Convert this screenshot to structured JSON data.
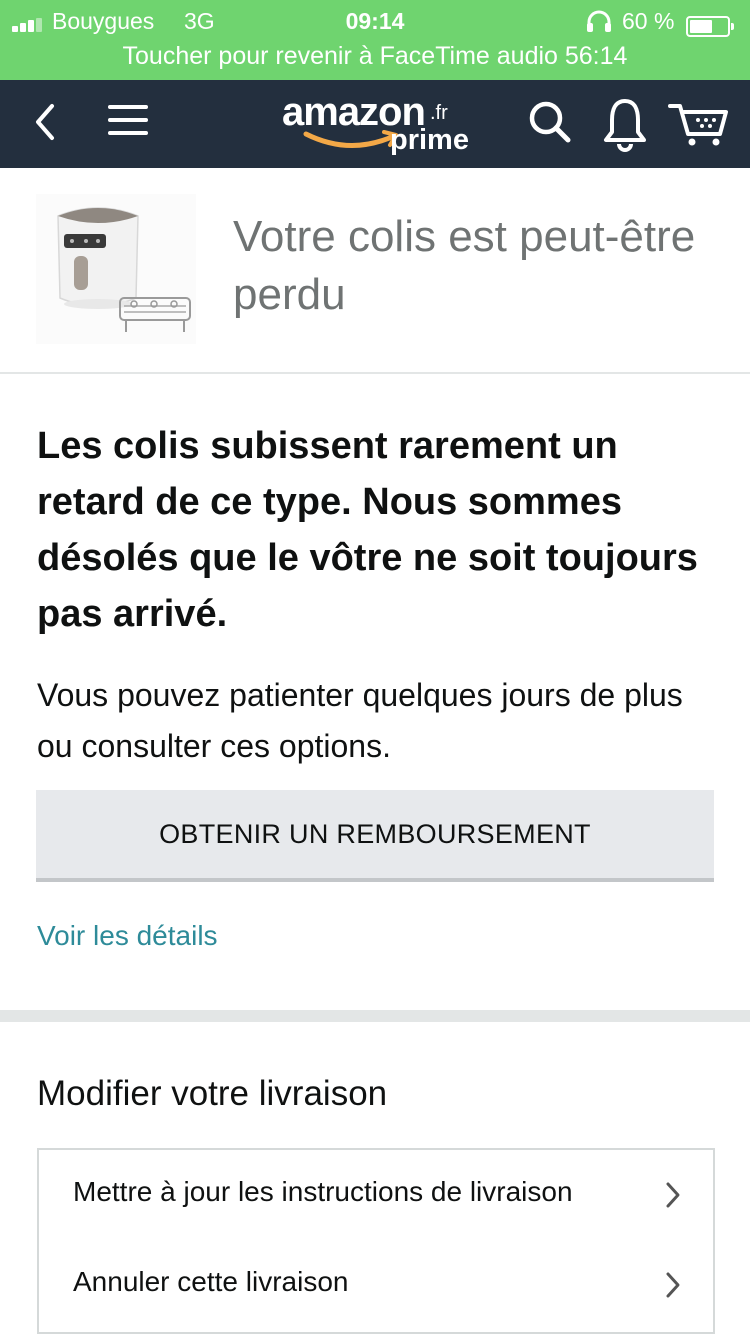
{
  "status_bar": {
    "carrier": "Bouygues",
    "network": "3G",
    "time": "09:14",
    "battery_text": "60 %",
    "battery_level": 0.6,
    "facetime_banner": "Toucher pour revenir à FaceTime audio 56:14",
    "icons": [
      "signal-icon",
      "headphones-icon",
      "battery-icon"
    ],
    "color": "#6fd46f"
  },
  "nav": {
    "logo_brand": "amazon",
    "logo_domain": ".fr",
    "logo_tier": "prime",
    "icons": [
      "back-icon",
      "menu-icon",
      "search-icon",
      "bell-icon",
      "cart-icon"
    ],
    "background": "#232f3e",
    "accent": "#f3a847"
  },
  "product": {
    "title": "Votre colis est peut-être perdu",
    "image": "air-fryer-product-image"
  },
  "message": {
    "headline": "Les colis subissent rarement un retard de ce type. Nous sommes désolés que le vôtre ne soit toujours pas arrivé.",
    "subtext": "Vous pouvez patienter quelques jours de plus ou consulter ces options.",
    "refund_button": "OBTENIR UN REMBOURSEMENT",
    "details_link": "Voir les détails",
    "link_color": "#2e8b99"
  },
  "delivery": {
    "section_title": "Modifier votre livraison",
    "options": [
      {
        "label": "Mettre à jour les instructions de livraison"
      },
      {
        "label": "Annuler cette livraison"
      }
    ]
  }
}
